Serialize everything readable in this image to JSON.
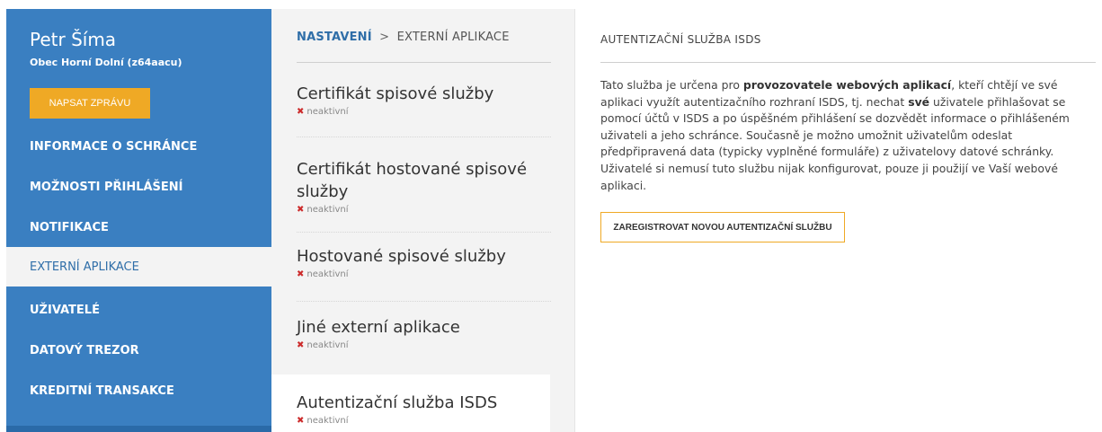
{
  "sidebar": {
    "user_name": "Petr Šíma",
    "org": "Obec Horní Dolní (z64aacu)",
    "compose_label": "NAPSAT ZPRÁVU",
    "items": [
      {
        "label": "INFORMACE O SCHRÁNCE"
      },
      {
        "label": "MOŽNOSTI PŘIHLÁŠENÍ"
      },
      {
        "label": "NOTIFIKACE"
      },
      {
        "label": "EXTERNÍ APLIKACE",
        "active": true
      },
      {
        "label": "UŽIVATELÉ"
      },
      {
        "label": "DATOVÝ TREZOR"
      },
      {
        "label": "KREDITNÍ TRANSAKCE"
      }
    ]
  },
  "breadcrumb": {
    "link": "NASTAVENÍ",
    "separator": ">",
    "current": "EXTERNÍ APLIKACE"
  },
  "apps": [
    {
      "title": "Certifikát spisové služby",
      "status": "neaktivní"
    },
    {
      "title": "Certifikát hostované spisové služby",
      "status": "neaktivní"
    },
    {
      "title": "Hostované spisové služby",
      "status": "neaktivní"
    },
    {
      "title": "Jiné externí aplikace",
      "status": "neaktivní"
    },
    {
      "title": "Autentizační služba ISDS",
      "status": "neaktivní",
      "selected": true
    }
  ],
  "detail": {
    "title": "AUTENTIZAČNÍ SLUŽBA ISDS",
    "text_1": "Tato služba je určena pro ",
    "text_bold_1": "provozovatele webových aplikací",
    "text_2": ", kteří chtějí ve své aplikaci využít autentizačního rozhraní ISDS, tj. nechat ",
    "text_bold_2": "své",
    "text_3": " uživatele přihlašovat se pomocí účtů v ISDS a po úspěšném přihlášení se dozvědět informace o přihlášeném uživateli a jeho schránce. Současně je možno umožnit uživatelům odeslat předpřipravená data (typicky vyplněné formuláře) z uživatelovy datové schránky. Uživatelé si nemusí tuto službu nijak konfigurovat, pouze ji použijí ve Vaší webové aplikaci.",
    "register_label": "ZAREGISTROVAT NOVOU AUTENTIZAČNÍ SLUŽBU"
  },
  "colors": {
    "sidebar": "#3a7fc1",
    "accent": "#efa925",
    "link": "#2f6ea8",
    "inactive_x": "#cc2b2b"
  }
}
